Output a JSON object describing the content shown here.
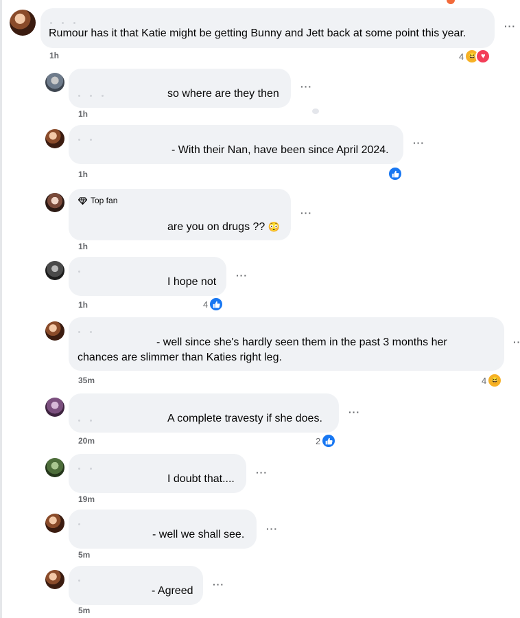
{
  "comments": [
    {
      "id": "c1",
      "text": "Rumour has it that Katie might be getting Bunny and Jett back at some point this year.",
      "time": "1h",
      "reaction_count": "4",
      "reaction_icons": [
        "haha",
        "love"
      ],
      "badge": ""
    },
    {
      "id": "r1",
      "text": "so where are they then",
      "time": "1h",
      "reaction_count": "",
      "reaction_icons": [],
      "badge": ""
    },
    {
      "id": "r2",
      "text": "- With their Nan, have been since April 2024.",
      "time": "1h",
      "reaction_count": "",
      "reaction_icons": [
        "like"
      ],
      "badge": ""
    },
    {
      "id": "r3",
      "text": "are you on drugs ??",
      "time": "1h",
      "reaction_count": "",
      "reaction_icons": [],
      "badge": "Top fan",
      "emoji": "😳"
    },
    {
      "id": "r4",
      "text": "I hope not",
      "time": "1h",
      "reaction_count": "4",
      "reaction_icons": [
        "like"
      ],
      "badge": ""
    },
    {
      "id": "r5",
      "text_line1": "- well since she's hardly seen them in the past 3 months her",
      "text_line2": "chances are slimmer than Katies right leg.",
      "time": "35m",
      "reaction_count": "4",
      "reaction_icons": [
        "haha"
      ],
      "badge": ""
    },
    {
      "id": "r6",
      "text": "A complete travesty if she does.",
      "time": "20m",
      "reaction_count": "2",
      "reaction_icons": [
        "like"
      ],
      "badge": ""
    },
    {
      "id": "r7",
      "text": "I doubt that....",
      "time": "19m",
      "reaction_count": "",
      "reaction_icons": [],
      "badge": ""
    },
    {
      "id": "r8",
      "text": "- well we shall see.",
      "time": "5m",
      "reaction_count": "",
      "reaction_icons": [],
      "badge": ""
    },
    {
      "id": "r9",
      "text": "- Agreed",
      "time": "5m",
      "reaction_count": "",
      "reaction_icons": [],
      "badge": ""
    }
  ],
  "more_label": "···",
  "icons": {
    "like": "thumbs-up-icon",
    "haha": "haha-emoji-icon",
    "love": "love-heart-icon",
    "topfan": "diamond-icon",
    "more": "more-options-icon"
  },
  "colors": {
    "bubble": "#f0f2f5",
    "meta": "#65676b",
    "like": "#1877f2",
    "haha": "#f7b125",
    "love": "#f33e58"
  }
}
